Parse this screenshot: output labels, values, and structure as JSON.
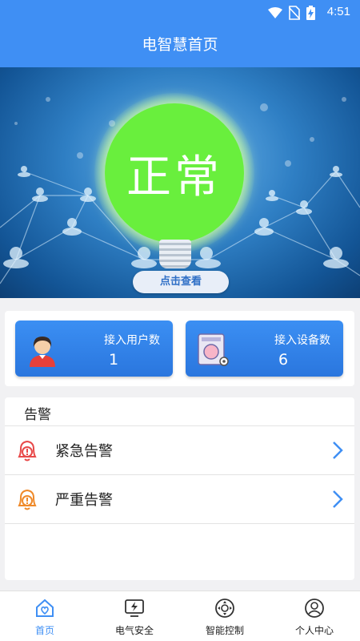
{
  "status_bar": {
    "time": "4:51",
    "icons": [
      "wifi-icon",
      "no-sim-icon",
      "battery-charging-icon"
    ]
  },
  "app_bar": {
    "title": "电智慧首页"
  },
  "hero": {
    "status_text": "正常",
    "status_color": "#69ef3d",
    "check_button": "点击查看"
  },
  "stats": {
    "users": {
      "label": "接入用户数",
      "value": "1",
      "icon": "user-avatar-icon"
    },
    "devices": {
      "label": "接入设备数",
      "value": "6",
      "icon": "device-meter-icon"
    }
  },
  "alarms": {
    "title": "告警",
    "items": [
      {
        "label": "紧急告警",
        "icon": "alarm-bell-icon",
        "color": "#e84a4a"
      },
      {
        "label": "严重告警",
        "icon": "alarm-bell-icon",
        "color": "#ef8a2a"
      }
    ]
  },
  "bottom_nav": {
    "items": [
      {
        "label": "首页",
        "icon": "home-icon",
        "active": true
      },
      {
        "label": "电气安全",
        "icon": "electric-safety-icon",
        "active": false
      },
      {
        "label": "智能控制",
        "icon": "smart-control-icon",
        "active": false
      },
      {
        "label": "个人中心",
        "icon": "profile-icon",
        "active": false
      }
    ]
  },
  "colors": {
    "primary": "#3f8ff4",
    "text": "#222222",
    "active_nav": "#3f8ff4"
  }
}
